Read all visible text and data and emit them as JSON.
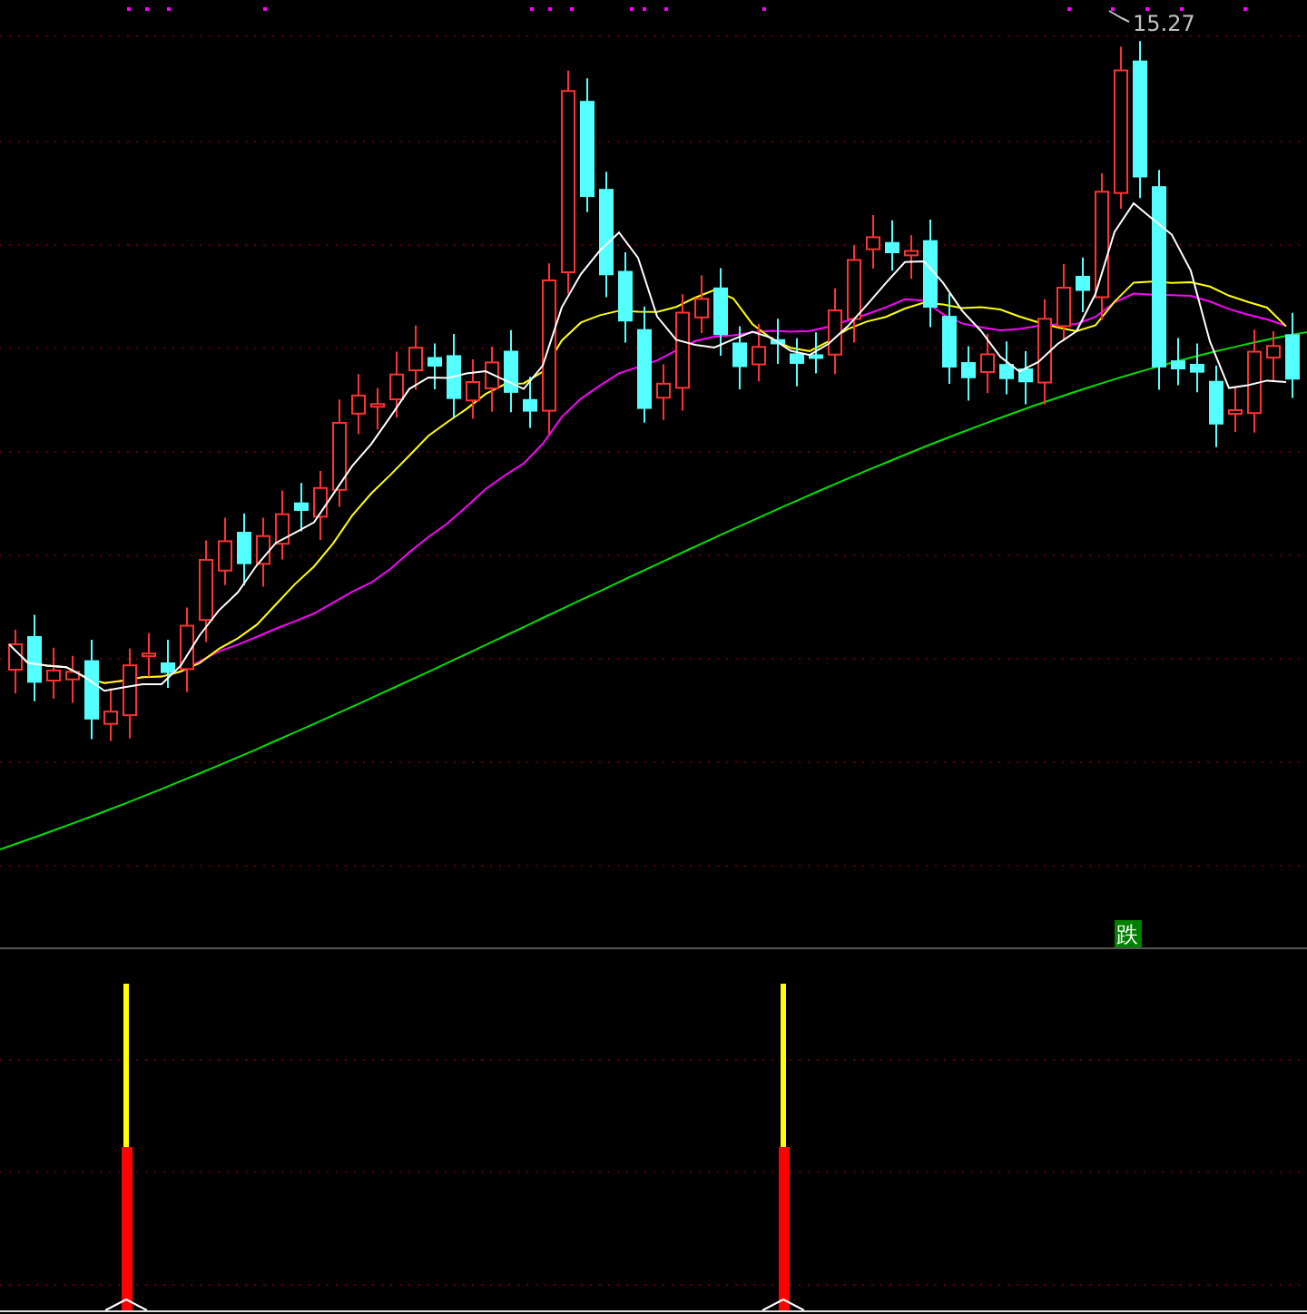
{
  "price_chart": {
    "high_label": "15.27",
    "signal_label": "跌"
  }
}
